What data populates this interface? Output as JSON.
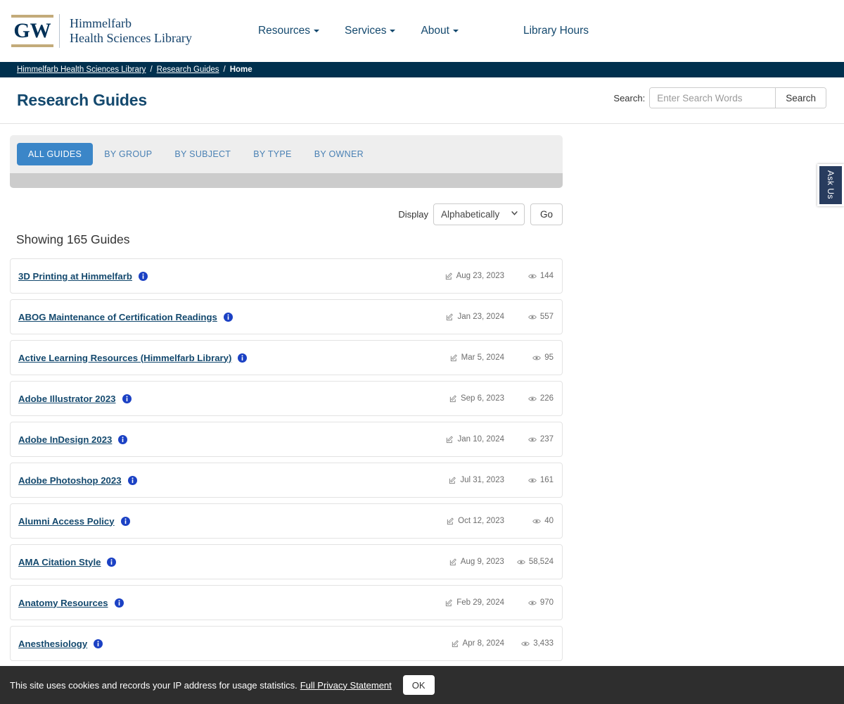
{
  "header": {
    "logo": {
      "mark_text": "GW",
      "line1": "Himmelfarb",
      "line2": "Health Sciences Library"
    },
    "nav": [
      {
        "label": "Resources",
        "has_caret": true
      },
      {
        "label": "Services",
        "has_caret": true
      },
      {
        "label": "About",
        "has_caret": true
      },
      {
        "label": "Library Hours",
        "has_caret": false
      }
    ]
  },
  "breadcrumb": {
    "items": [
      {
        "label": "Himmelfarb Health Sciences Library",
        "current": false
      },
      {
        "label": "Research Guides",
        "current": false
      },
      {
        "label": "Home",
        "current": true
      }
    ],
    "separator": "/"
  },
  "page": {
    "title": "Research Guides"
  },
  "search": {
    "label": "Search:",
    "placeholder": "Enter Search Words",
    "value": "",
    "button_label": "Search"
  },
  "tabs": [
    {
      "label": "ALL GUIDES",
      "active": true
    },
    {
      "label": "BY GROUP",
      "active": false
    },
    {
      "label": "BY SUBJECT",
      "active": false
    },
    {
      "label": "BY TYPE",
      "active": false
    },
    {
      "label": "BY OWNER",
      "active": false
    }
  ],
  "display_controls": {
    "label": "Display",
    "selected": "Alphabetically",
    "options": [
      "Alphabetically"
    ],
    "go_label": "Go"
  },
  "results": {
    "showing_text": "Showing 165 Guides",
    "count": 165
  },
  "guides": [
    {
      "title": "3D Printing at Himmelfarb",
      "date": "Aug 23, 2023",
      "views": "144"
    },
    {
      "title": "ABOG Maintenance of Certification Readings",
      "date": "Jan 23, 2024",
      "views": "557"
    },
    {
      "title": "Active Learning Resources (Himmelfarb Library)",
      "date": "Mar 5, 2024",
      "views": "95"
    },
    {
      "title": "Adobe Illustrator 2023",
      "date": "Sep 6, 2023",
      "views": "226"
    },
    {
      "title": "Adobe InDesign 2023",
      "date": "Jan 10, 2024",
      "views": "237"
    },
    {
      "title": "Adobe Photoshop 2023",
      "date": "Jul 31, 2023",
      "views": "161"
    },
    {
      "title": "Alumni Access Policy",
      "date": "Oct 12, 2023",
      "views": "40"
    },
    {
      "title": "AMA Citation Style",
      "date": "Aug 9, 2023",
      "views": "58,524"
    },
    {
      "title": "Anatomy Resources",
      "date": "Feb 29, 2024",
      "views": "970"
    },
    {
      "title": "Anesthesiology",
      "date": "Apr 8, 2024",
      "views": "3,433"
    }
  ],
  "ask_us": {
    "label": "Ask Us"
  },
  "cookie_banner": {
    "text": "This site uses cookies and records your IP address for usage statistics.",
    "link_label": "Full Privacy Statement",
    "ok_label": "OK"
  },
  "colors": {
    "brand_navy": "#14496e",
    "breadcrumb_bg": "#00304e",
    "gw_gold": "#c3ab7a",
    "tab_active_bg": "#3b86c8",
    "tab_link": "#4a81b4",
    "info_icon": "#1b41c4",
    "cookie_bg": "#2e2e2e",
    "ask_us_bg": "#283c5e"
  }
}
